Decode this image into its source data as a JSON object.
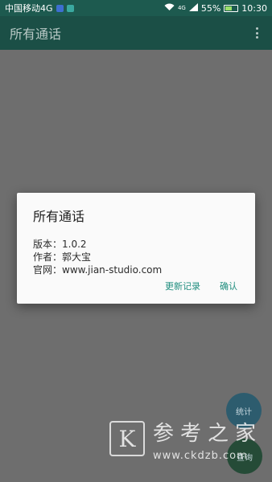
{
  "status_bar": {
    "carrier": "中国移动4G",
    "signal_label": "4G",
    "battery": "55%",
    "battery_level": 0.55,
    "time": "10:30"
  },
  "app_bar": {
    "title": "所有通话"
  },
  "dialog": {
    "title": "所有通话",
    "version": "版本：1.0.2",
    "author": "作者：郭大宝",
    "website": "官网：www.jian-studio.com",
    "changelog_button": "更新记录",
    "ok_button": "确认"
  },
  "fabs": {
    "stats": "统计",
    "query": "查询"
  },
  "watermark": {
    "logo_letter": "K",
    "name": "参考之家",
    "url": "www.ckdzb.com"
  },
  "colors": {
    "status_bar": "#1d5a4f",
    "app_bar": "#1b4f46",
    "accent": "#1f8d7e",
    "overlay": "#6e6e6e"
  }
}
